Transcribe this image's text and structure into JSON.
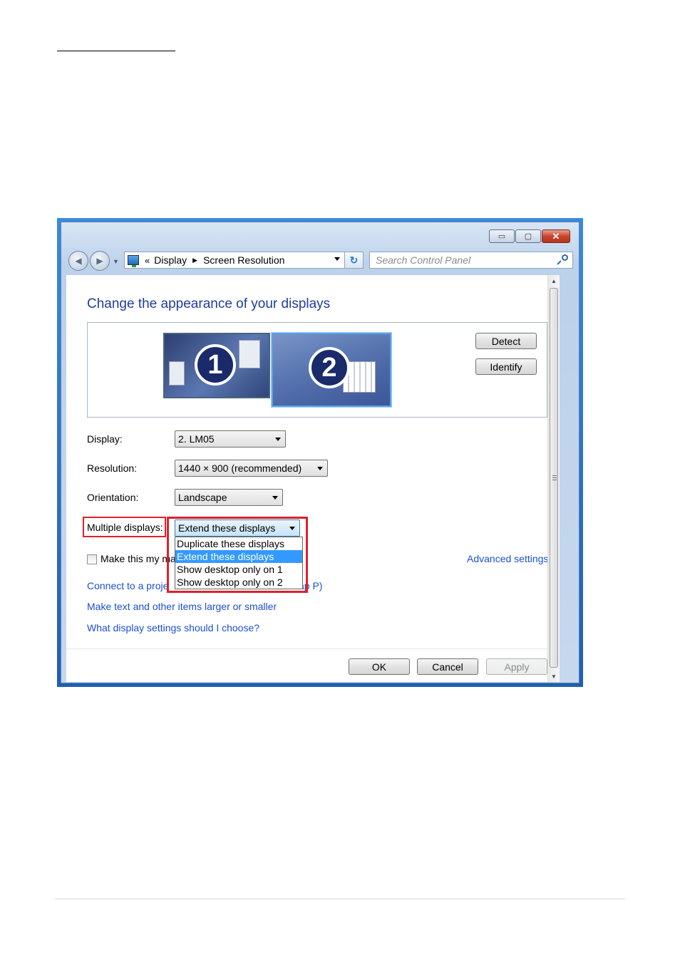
{
  "window": {
    "breadcrumb": {
      "prefix": "«",
      "items": [
        "Display",
        "Screen Resolution"
      ]
    },
    "search_placeholder": "Search Control Panel"
  },
  "page": {
    "title": "Change the appearance of your displays",
    "monitors": [
      "1",
      "2"
    ],
    "detect_label": "Detect",
    "identify_label": "Identify",
    "display": {
      "label": "Display:",
      "value": "2. LM05"
    },
    "resolution": {
      "label": "Resolution:",
      "value": "1440 × 900 (recommended)"
    },
    "orientation": {
      "label": "Orientation:",
      "value": "Landscape"
    },
    "multiple": {
      "label": "Multiple displays:",
      "value": "Extend these displays",
      "options": [
        "Duplicate these displays",
        "Extend these displays",
        "Show desktop only on 1",
        "Show desktop only on 2"
      ]
    },
    "checkbox_label": "Make this my ma",
    "advanced_link": "Advanced settings",
    "links": {
      "connect_prefix": "Connect to a proje",
      "connect_suffix": "ap P)",
      "text_size": "Make text and other items larger or smaller",
      "which_settings": "What display settings should I choose?"
    },
    "buttons": {
      "ok": "OK",
      "cancel": "Cancel",
      "apply": "Apply"
    }
  },
  "colors": {
    "link": "#1b4fd0",
    "title": "#1e3d9b",
    "highlight": "#e0202a",
    "selection": "#3399ff"
  }
}
